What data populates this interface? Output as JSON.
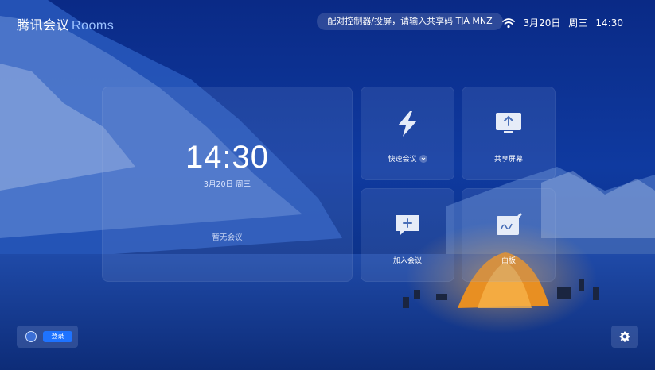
{
  "brand": {
    "name_zh": "腾讯会议",
    "name_en": "Rooms"
  },
  "header": {
    "share_hint": "配对控制器/投屏，请输入共享码 TJA MNZ",
    "date": "3月20日",
    "weekday": "周三",
    "time": "14:30"
  },
  "clock": {
    "time": "14:30",
    "date": "3月20日 周三",
    "empty": "暂无会议"
  },
  "tiles": [
    {
      "label": "快速会议",
      "icon": "lightning-icon"
    },
    {
      "label": "共享屏幕",
      "icon": "share-screen-icon"
    },
    {
      "label": "加入会议",
      "icon": "join-meeting-icon"
    },
    {
      "label": "白板",
      "icon": "whiteboard-icon"
    }
  ],
  "footer": {
    "login_label": "登录",
    "settings_icon": "gear-icon"
  },
  "colors": {
    "accent": "#1e73ff",
    "background": "#0b2b74"
  }
}
